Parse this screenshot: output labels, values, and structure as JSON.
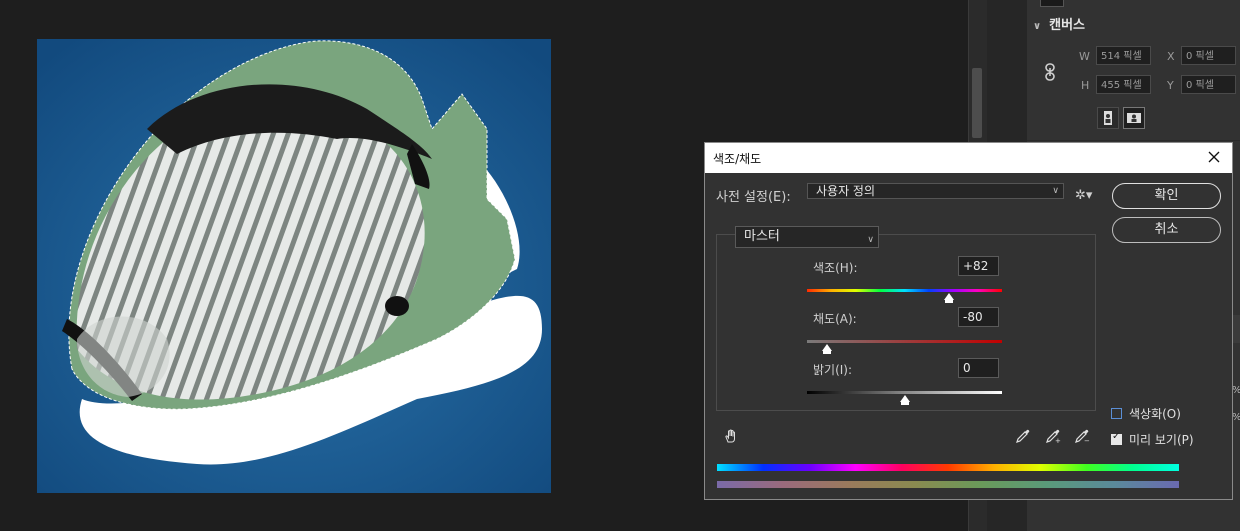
{
  "canvas_panel": {
    "title": "캔버스",
    "width_label": "W",
    "width_value": "514 픽셀",
    "height_label": "H",
    "height_value": "455 픽셀",
    "x_label": "X",
    "x_value": "0 픽셀",
    "y_label": "Y",
    "y_value": "0 픽셀",
    "side_pct_1": "%",
    "side_pct_2": "%"
  },
  "dialog": {
    "title": "색조/채도",
    "preset_label": "사전 설정(E):",
    "preset_value": "사용자 정의",
    "ok_label": "확인",
    "cancel_label": "취소",
    "channel_value": "마스터",
    "hue_label": "색조(H):",
    "hue_value": "+82",
    "saturation_label": "채도(A):",
    "saturation_value": "-80",
    "lightness_label": "밝기(I):",
    "lightness_value": "0",
    "colorize_label": "색상화(O)",
    "colorize_checked": false,
    "preview_label": "미리 보기(P)",
    "preview_checked": true
  },
  "slider_levels": {
    "hue": 82,
    "saturation": -80,
    "lightness": 0
  },
  "colors": {
    "panel_bg": "#323232",
    "workspace_bg": "#1e1e1e",
    "ocean_blue": "#1a5d95",
    "fish_green_tint": "#7aa57e",
    "checkbox_accent": "#5b8fd6"
  }
}
